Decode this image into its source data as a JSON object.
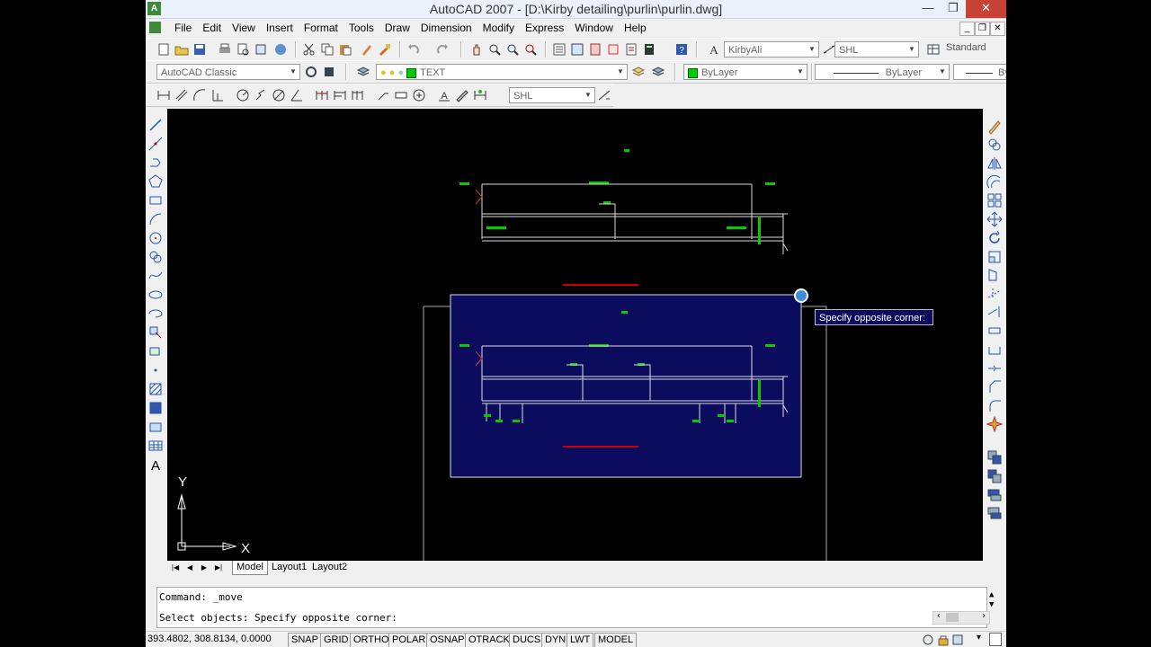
{
  "window": {
    "title": "AutoCAD 2007 - [D:\\Kirby detailing\\purlin\\purlin.dwg]",
    "app_icon": "A",
    "minimize": "—",
    "maximize": "❐",
    "close": "✕"
  },
  "menubar": {
    "items": [
      "File",
      "Edit",
      "View",
      "Insert",
      "Format",
      "Tools",
      "Draw",
      "Dimension",
      "Modify",
      "Express",
      "Window",
      "Help"
    ]
  },
  "toolbar": {
    "text_style": "KirbyAli",
    "dim_style": "SHL",
    "table_style": "Standard",
    "workspace": "AutoCAD Classic",
    "layer": "TEXT",
    "color": "ByLayer",
    "linetype": "ByLayer",
    "lineweight": "ByL",
    "dimstyle_current": "SHL"
  },
  "tooltip": "Specify opposite corner:",
  "layout_tabs": [
    "Model",
    "Layout1",
    "Layout2"
  ],
  "ucs": {
    "x_label": "X",
    "y_label": "Y"
  },
  "command": {
    "line1": "Command:  _move",
    "line2": "Select objects: Specify opposite corner:"
  },
  "status": {
    "coordinates": "393.4802, 308.8134, 0.0000",
    "buttons": [
      "SNAP",
      "GRID",
      "ORTHO",
      "POLAR",
      "OSNAP",
      "OTRACK",
      "DUCS",
      "DYN",
      "LWT",
      "MODEL"
    ]
  },
  "colors": {
    "accent_selection": "#0c0c5e",
    "drawing_green": "#00cc00",
    "drawing_red": "#cc0000"
  }
}
